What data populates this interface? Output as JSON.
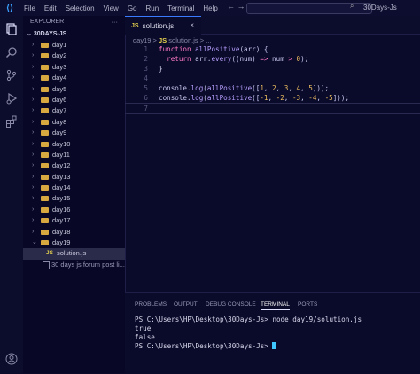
{
  "menu": {
    "items": [
      "File",
      "Edit",
      "Selection",
      "View",
      "Go",
      "Run",
      "Terminal",
      "Help"
    ]
  },
  "titlebar": {
    "nav": "← →",
    "search_text": "30Days-Js"
  },
  "explorer": {
    "title": "EXPLORER",
    "root": "30DAYS-JS",
    "folders": [
      "day1",
      "day2",
      "day3",
      "day4",
      "day5",
      "day6",
      "day7",
      "day8",
      "day9",
      "day10",
      "day11",
      "day12",
      "day13",
      "day14",
      "day15",
      "day16",
      "day17",
      "day18",
      "day19"
    ],
    "open_folder": "day19",
    "file": "solution.js",
    "md_file": "30 days js forum post li..."
  },
  "tab": {
    "badge": "JS",
    "label": "solution.js",
    "close": "×"
  },
  "breadcrumb": {
    "folder": "day19",
    "sep": ">",
    "badge": "JS",
    "file": "solution.js",
    "more": "> ..."
  },
  "editor": {
    "line_numbers": [
      "1",
      "2",
      "3",
      "4",
      "5",
      "6",
      "7"
    ],
    "lines": [
      [
        {
          "t": "function ",
          "c": "kw"
        },
        {
          "t": "allPositive",
          "c": "fn"
        },
        {
          "t": "(arr) {",
          "c": "id"
        }
      ],
      [
        {
          "t": "  return ",
          "c": "kw"
        },
        {
          "t": "arr.",
          "c": "id"
        },
        {
          "t": "every",
          "c": "fn"
        },
        {
          "t": "((num) ",
          "c": "id"
        },
        {
          "t": "=>",
          "c": "op"
        },
        {
          "t": " num ",
          "c": "id"
        },
        {
          "t": ">",
          "c": "op"
        },
        {
          "t": " 0",
          "c": "num"
        },
        {
          "t": ");",
          "c": "id"
        }
      ],
      [
        {
          "t": "}",
          "c": "br"
        }
      ],
      [],
      [
        {
          "t": "console.",
          "c": "id"
        },
        {
          "t": "log",
          "c": "fn"
        },
        {
          "t": "(",
          "c": "id"
        },
        {
          "t": "allPositive",
          "c": "fn"
        },
        {
          "t": "([",
          "c": "id"
        },
        {
          "t": "1",
          "c": "num"
        },
        {
          "t": ", ",
          "c": "id"
        },
        {
          "t": "2",
          "c": "num"
        },
        {
          "t": ", ",
          "c": "id"
        },
        {
          "t": "3",
          "c": "num"
        },
        {
          "t": ", ",
          "c": "id"
        },
        {
          "t": "4",
          "c": "num"
        },
        {
          "t": ", ",
          "c": "id"
        },
        {
          "t": "5",
          "c": "num"
        },
        {
          "t": "]));",
          "c": "id"
        }
      ],
      [
        {
          "t": "console.",
          "c": "id"
        },
        {
          "t": "log",
          "c": "fn"
        },
        {
          "t": "(",
          "c": "id"
        },
        {
          "t": "allPositive",
          "c": "fn"
        },
        {
          "t": "([",
          "c": "id"
        },
        {
          "t": "-1",
          "c": "num"
        },
        {
          "t": ", ",
          "c": "id"
        },
        {
          "t": "-2",
          "c": "num"
        },
        {
          "t": ", ",
          "c": "id"
        },
        {
          "t": "-3",
          "c": "num"
        },
        {
          "t": ", ",
          "c": "id"
        },
        {
          "t": "-4",
          "c": "num"
        },
        {
          "t": ", ",
          "c": "id"
        },
        {
          "t": "-5",
          "c": "num"
        },
        {
          "t": "]));",
          "c": "id"
        }
      ],
      []
    ]
  },
  "panel": {
    "tabs": [
      "PROBLEMS",
      "OUTPUT",
      "DEBUG CONSOLE",
      "TERMINAL",
      "PORTS"
    ],
    "active_tab": "TERMINAL"
  },
  "terminal": {
    "lines": [
      "PS C:\\Users\\HP\\Desktop\\30Days-Js> node day19/solution.js",
      "true",
      "false",
      "PS C:\\Users\\HP\\Desktop\\30Days-Js> "
    ]
  },
  "colors": {
    "background": "#0a0a2a",
    "accent": "#3aa0ff",
    "keyword": "#ff79c6",
    "function": "#b8a0ff",
    "number": "#f0c060",
    "folder": "#d8a840",
    "js_badge": "#e8d44d",
    "terminal_cursor": "#3ec8ff"
  },
  "icons": [
    "vscode-logo-icon",
    "explorer-icon",
    "search-icon",
    "source-control-icon",
    "run-debug-icon",
    "extensions-icon",
    "account-icon"
  ]
}
